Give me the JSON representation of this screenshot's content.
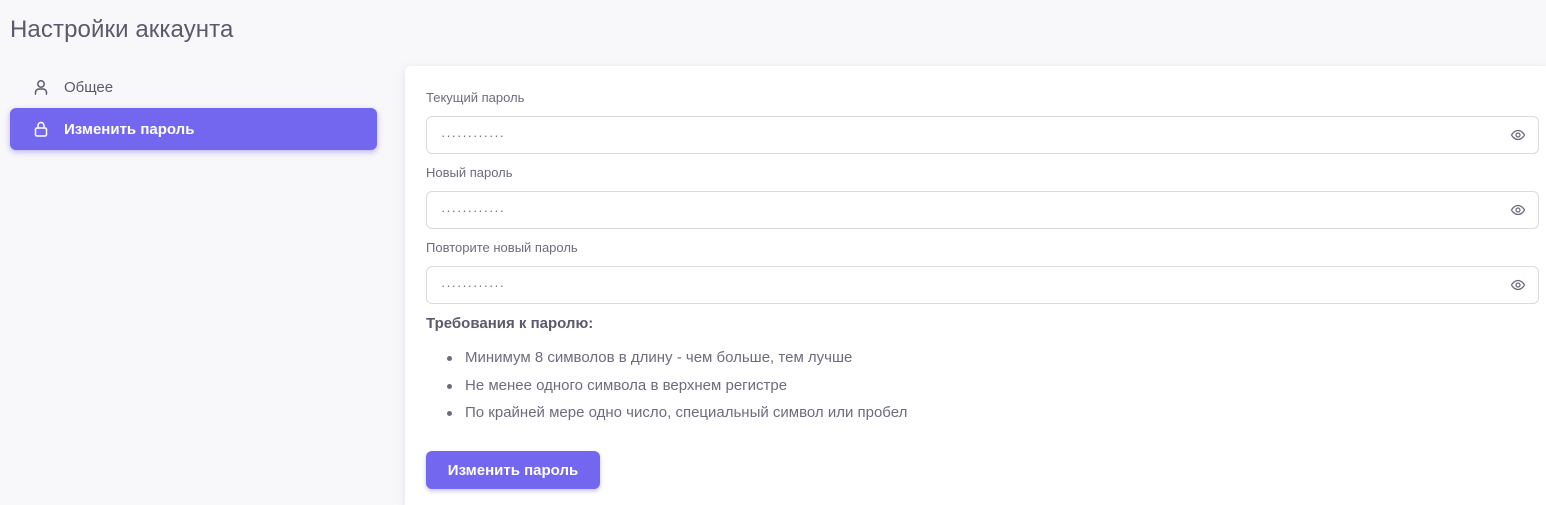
{
  "page": {
    "title": "Настройки аккаунта"
  },
  "sidebar": {
    "items": [
      {
        "label": "Общее",
        "icon": "user-icon",
        "active": false
      },
      {
        "label": "Изменить пароль",
        "icon": "lock-icon",
        "active": true
      }
    ]
  },
  "form": {
    "fields": [
      {
        "label": "Текущий пароль",
        "value": "············",
        "type": "password"
      },
      {
        "label": "Новый пароль",
        "value": "············",
        "type": "password"
      },
      {
        "label": "Повторите новый пароль",
        "value": "············",
        "type": "password"
      }
    ],
    "requirements_title": "Требования к паролю:",
    "requirements": [
      "Минимум 8 символов в длину - чем больше, тем лучше",
      "Не менее одного символа в верхнем регистре",
      "По крайней мере одно число, специальный символ или пробел"
    ],
    "submit_label": "Изменить пароль"
  },
  "colors": {
    "accent": "#7367f0",
    "background": "#f8f7fa",
    "card": "#ffffff",
    "text": "#5d596c",
    "border": "#dbdade"
  }
}
